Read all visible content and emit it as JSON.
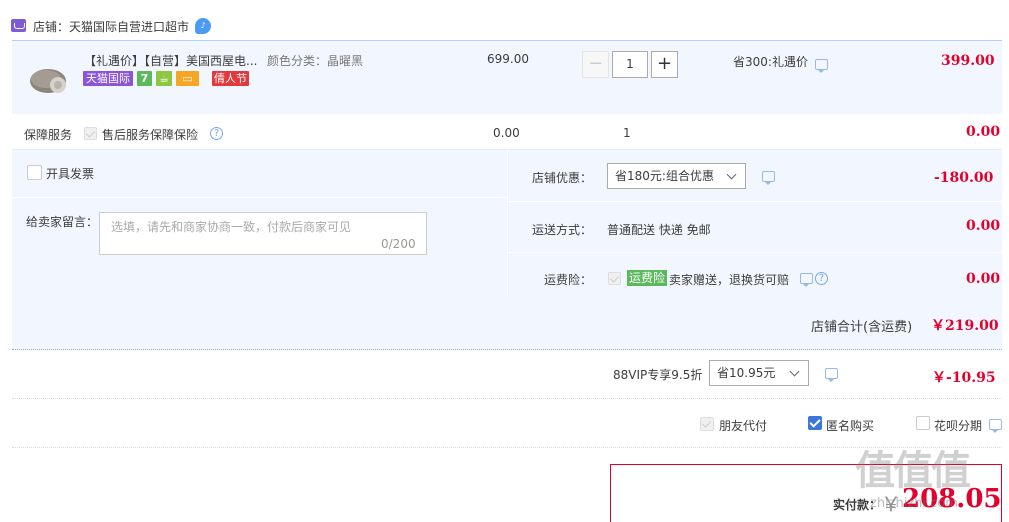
{
  "shop": {
    "label": "店铺：天猫国际自营进口超市"
  },
  "item": {
    "title": "【礼遇价】【自营】美国西屋电...",
    "sku": "颜色分类：晶曜黑",
    "tags": {
      "intl": "天猫国际",
      "seven": "7",
      "fest": "倩人节"
    },
    "price": "699.00",
    "quantity": "1",
    "promo": "省300:礼遇价",
    "amount": "399.00"
  },
  "insurance": {
    "label": "保障服务",
    "option": "售后服务保障保险",
    "price": "0.00",
    "qty": "1",
    "amount": "0.00"
  },
  "invoice": {
    "label": "开具发票"
  },
  "message": {
    "label": "给卖家留言：",
    "placeholder": "选填，请先和商家协商一致，付款后商家可见",
    "count": "0/200"
  },
  "shop_discount": {
    "label": "店铺优惠：",
    "selected": "省180元:组合优惠",
    "amount": "-180.00"
  },
  "shipping": {
    "label": "运送方式：",
    "value": "普通配送 快递 免邮",
    "amount": "0.00"
  },
  "freight_ins": {
    "label": "运费险：",
    "tag": "运费险",
    "desc": "卖家赠送，退换货可赔",
    "amount": "0.00"
  },
  "subtotal": {
    "label": "店铺合计(含运费)",
    "amount": "￥219.00"
  },
  "vip": {
    "label": "88VIP专享9.5折",
    "selected": "省10.95元",
    "amount": "￥-10.95"
  },
  "options": {
    "friend_pay": "朋友代付",
    "anonymous": "匿名购买",
    "huabei": "花呗分期"
  },
  "pay": {
    "label": "实付款：",
    "amount": "208.05",
    "currency": "￥"
  },
  "watermark": {
    "main": "值值值",
    "sub": "zhizhizhi.com"
  },
  "colors": {
    "accent": "#e4002b",
    "panel": "#f2f7ff",
    "link": "#3b76d8"
  }
}
